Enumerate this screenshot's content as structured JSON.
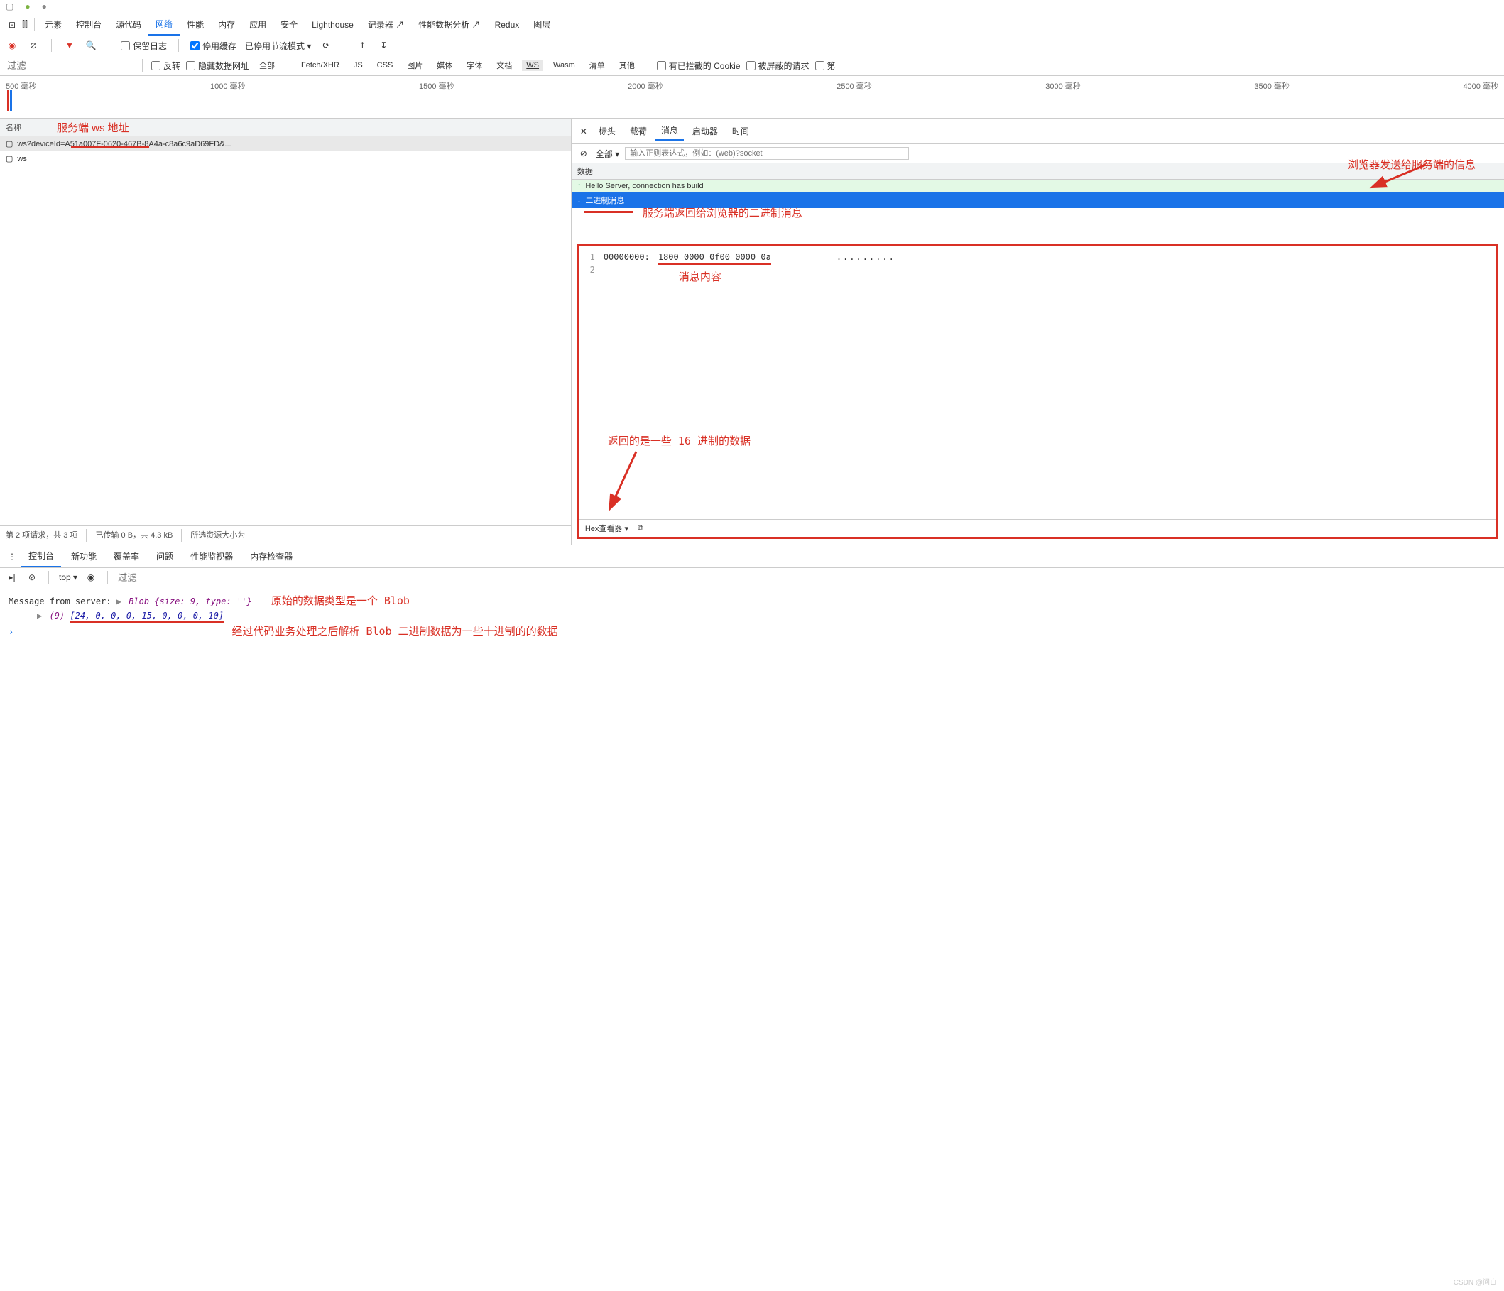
{
  "top_tabs": [
    "元素",
    "控制台",
    "源代码",
    "网络",
    "性能",
    "内存",
    "应用",
    "安全",
    "Lighthouse",
    "记录器",
    "性能数据分析",
    "Redux",
    "图层"
  ],
  "top_active": "网络",
  "toolbar": {
    "preserve_log": "保留日志",
    "disable_cache": "停用缓存",
    "throttling": "已停用节流模式"
  },
  "filter": {
    "placeholder": "过滤",
    "invert": "反转",
    "hide_data_urls": "隐藏数据网址",
    "types": [
      "全部",
      "Fetch/XHR",
      "JS",
      "CSS",
      "图片",
      "媒体",
      "字体",
      "文档",
      "WS",
      "Wasm",
      "清单",
      "其他"
    ],
    "selected_type": "WS",
    "blocked_cookies": "有已拦截的 Cookie",
    "blocked_requests": "被屏蔽的请求",
    "third_party": "第"
  },
  "timeline": [
    "500 毫秒",
    "1000 毫秒",
    "1500 毫秒",
    "2000 毫秒",
    "2500 毫秒",
    "3000 毫秒",
    "3500 毫秒",
    "4000 毫秒"
  ],
  "name_col": "名称",
  "requests": [
    {
      "name": "ws?deviceId=A51a007F-0620-467B-8A4a-c8a6c9aD69FD&..."
    },
    {
      "name": "ws"
    }
  ],
  "status": {
    "text": "第 2 项请求，共 3 项",
    "transferred": "已传输 0 B，共 4.3 kB",
    "resources": "所选资源大小为"
  },
  "detail_tabs": [
    "标头",
    "载荷",
    "消息",
    "启动器",
    "时间"
  ],
  "detail_active": "消息",
  "msg_filter": {
    "all": "全部",
    "placeholder": "输入正则表达式，例如：(web)?socket"
  },
  "data_label": "数据",
  "msg_up": "Hello Server, connection has build",
  "msg_down": "二进制消息",
  "hex": {
    "offset": "00000000:",
    "bytes": "1800 0000 0f00 0000 0a",
    "ascii": "........."
  },
  "hex_viewer": "Hex查看器",
  "annotations": {
    "ws_addr": "服务端 ws 地址",
    "browser_send": "浏览器发送给服务端的信息",
    "server_return": "服务端返回给浏览器的二进制消息",
    "msg_content": "消息内容",
    "hex_data": "返回的是一些 16 进制的数据",
    "blob_type": "原始的数据类型是一个 Blob",
    "decoded": "经过代码业务处理之后解析 Blob 二进制数据为一些十进制的的数据"
  },
  "drawer_tabs": [
    "控制台",
    "新功能",
    "覆盖率",
    "问题",
    "性能监视器",
    "内存检查器"
  ],
  "drawer_active": "控制台",
  "console": {
    "top": "top",
    "filter": "过滤",
    "line1_prefix": "Message from server:  ",
    "blob": "Blob {size: 9, type: ''}",
    "line2_prefix": "(9) ",
    "array": "[24, 0, 0, 0, 15, 0, 0, 0, 10]"
  },
  "watermark": "CSDN @问白"
}
